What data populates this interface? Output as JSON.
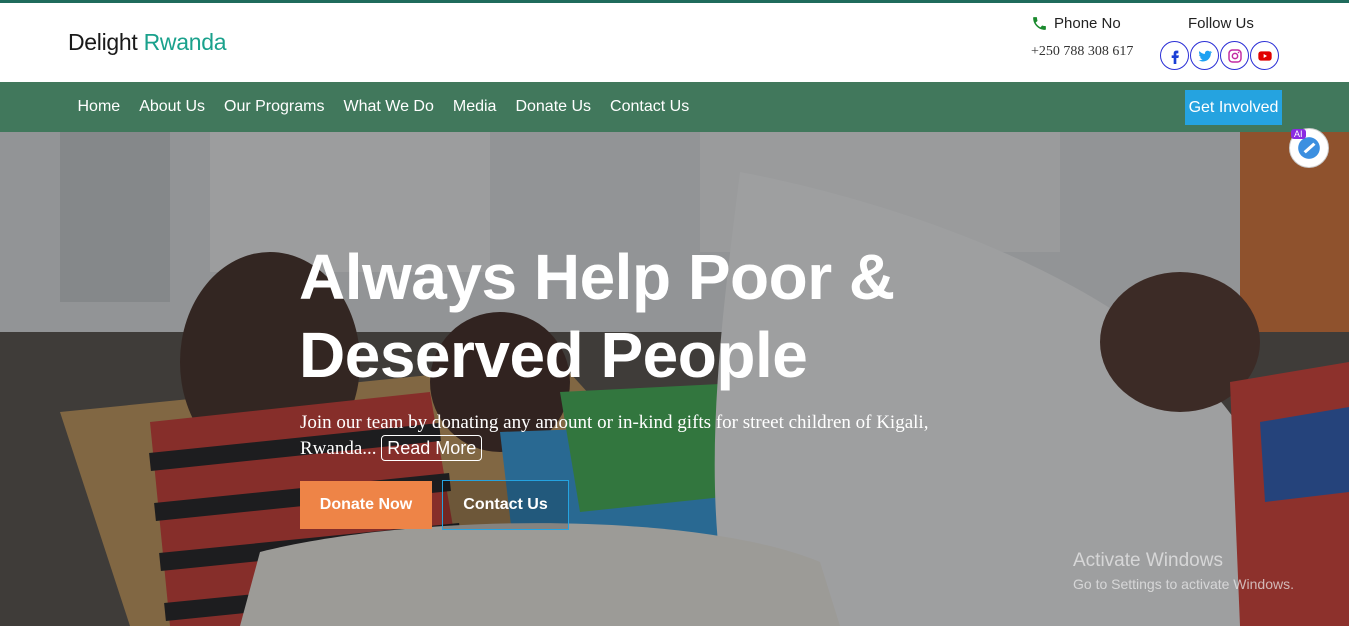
{
  "brand": {
    "name_part1": "Delight",
    "name_part2": "Rwanda"
  },
  "contact": {
    "phone_label": "Phone No",
    "phone_number": "+250 788 308 617"
  },
  "social": {
    "label": "Follow Us",
    "items": [
      {
        "name": "facebook-icon",
        "color": "#1a3fd6"
      },
      {
        "name": "twitter-icon",
        "color": "#1da1f2"
      },
      {
        "name": "instagram-icon",
        "color": "#c32aa3"
      },
      {
        "name": "youtube-icon",
        "color": "#e10000"
      }
    ]
  },
  "nav": {
    "items": [
      "Home",
      "About Us",
      "Our Programs",
      "What We Do",
      "Media",
      "Donate Us",
      "Contact Us"
    ],
    "cta": "Get Involved"
  },
  "hero": {
    "title_line1": "Always Help Poor &",
    "title_line2": "Deserved People",
    "text": "Join our team by donating any amount or in-kind gifts for street children of Kigali, Rwanda...",
    "read_more": "Read More",
    "donate_button": "Donate Now",
    "contact_button": "Contact Us"
  },
  "os_overlay": {
    "title": "Activate Windows",
    "subtitle": "Go to Settings to activate Windows."
  },
  "ai_badge": "AI",
  "colors": {
    "nav_bg": "#41785c",
    "brand_accent": "#1aa18c",
    "cta_blue": "#25a3e0",
    "donate_orange": "#ee8447"
  }
}
